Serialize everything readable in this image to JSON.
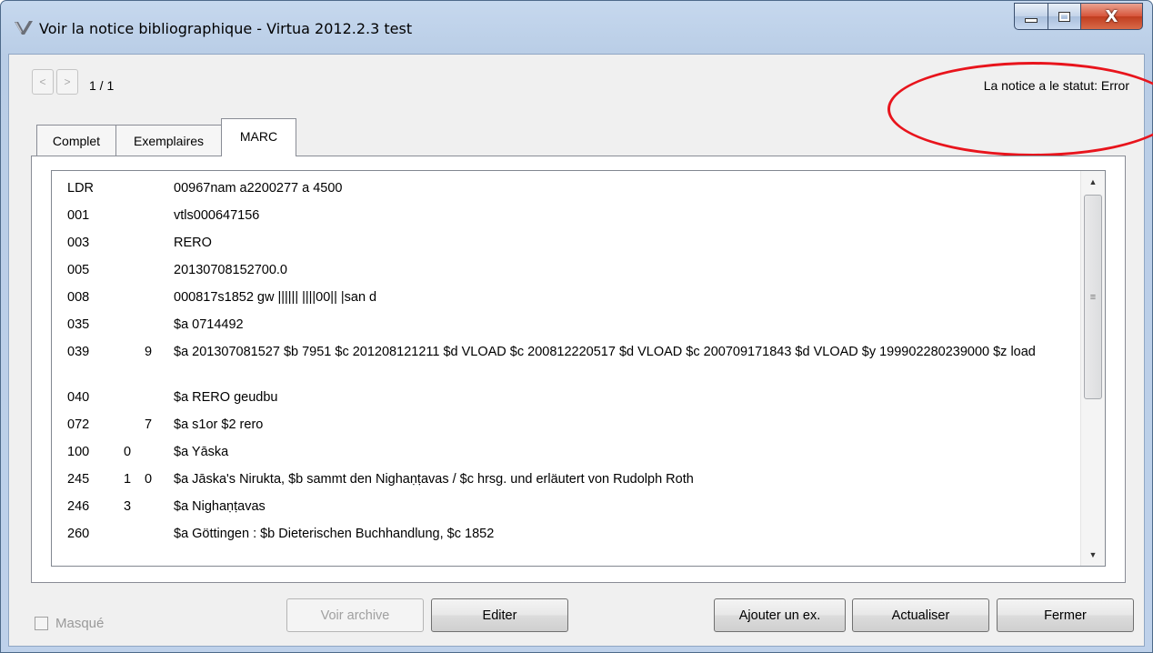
{
  "window": {
    "title": "Voir la notice bibliographique - Virtua 2012.2.3 test",
    "close_glyph": "X"
  },
  "toolbar": {
    "prev_label": "<",
    "next_label": ">",
    "pager": "1 / 1",
    "status_text": "La notice a le statut: Error"
  },
  "tabs": [
    {
      "label": "Complet",
      "active": false
    },
    {
      "label": "Exemplaires",
      "active": false
    },
    {
      "label": "MARC",
      "active": true
    }
  ],
  "marc": {
    "rows": [
      {
        "tag": "LDR",
        "ind1": "",
        "ind2": "",
        "content": "00967nam a2200277 a 4500"
      },
      {
        "tag": "001",
        "ind1": "",
        "ind2": "",
        "content": "vtls000647156"
      },
      {
        "tag": "003",
        "ind1": "",
        "ind2": "",
        "content": "RERO"
      },
      {
        "tag": "005",
        "ind1": "",
        "ind2": "",
        "content": "20130708152700.0"
      },
      {
        "tag": "008",
        "ind1": "",
        "ind2": "",
        "content": "000817s1852    gw |||||| ||||00|| |san d"
      },
      {
        "tag": "035",
        "ind1": "",
        "ind2": "",
        "content": "$a 0714492"
      },
      {
        "tag": "039",
        "ind1": "",
        "ind2": "9",
        "content": "$a 201307081527 $b 7951 $c 201208121211 $d VLOAD $c 200812220517 $d VLOAD $c 200709171843 $d VLOAD $y 199902280239000 $z load"
      },
      {
        "tag": "040",
        "ind1": "",
        "ind2": "",
        "content": "$a RERO geudbu"
      },
      {
        "tag": "072",
        "ind1": "",
        "ind2": "7",
        "content": "$a s1or $2 rero"
      },
      {
        "tag": "100",
        "ind1": "0",
        "ind2": "",
        "content": "$a Yāska"
      },
      {
        "tag": "245",
        "ind1": "1",
        "ind2": "0",
        "content": "$a Jāska's Nirukta, $b sammt den Nighaṇṭavas / $c hrsg. und erläutert von Rudolph Roth"
      },
      {
        "tag": "246",
        "ind1": "3",
        "ind2": "",
        "content": "$a Nighaṇṭavas"
      },
      {
        "tag": "260",
        "ind1": "",
        "ind2": "",
        "content": "$a Göttingen : $b Dieterischen Buchhandlung, $c 1852"
      }
    ]
  },
  "scrollbar": {
    "thumb_grip": "≡"
  },
  "footer": {
    "masque_label": "Masqué",
    "masque_checked": false,
    "voir_archive": "Voir archive",
    "editer": "Editer",
    "ajouter": "Ajouter un ex.",
    "actualiser": "Actualiser",
    "fermer": "Fermer"
  },
  "colors": {
    "annotation_red": "#e8141c",
    "titlebar": "#b9cde6"
  }
}
